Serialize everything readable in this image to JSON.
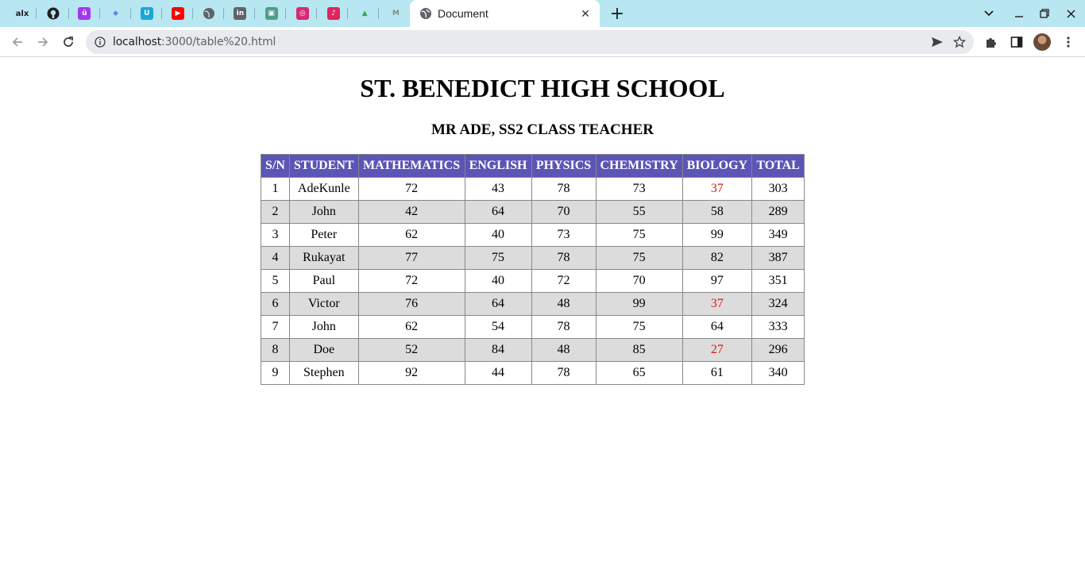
{
  "browser": {
    "pinned_tabs": [
      {
        "name": "alx-tab",
        "glyph": "alx",
        "color": "#1f1f1f",
        "bg": "transparent"
      },
      {
        "name": "github-tab",
        "glyph": "",
        "color": "#1f1f1f",
        "bg": "transparent"
      },
      {
        "name": "udemy-tab",
        "glyph": "ü",
        "color": "#ffffff",
        "bg": "#a435f0"
      },
      {
        "name": "sketch-tab",
        "glyph": "◆",
        "color": "#5b8def",
        "bg": "transparent"
      },
      {
        "name": "webflow-tab",
        "glyph": "U",
        "color": "#ffffff",
        "bg": "#1aa6d6"
      },
      {
        "name": "youtube-tab",
        "glyph": "▶",
        "color": "#ffffff",
        "bg": "#ff0000"
      },
      {
        "name": "web-tab",
        "glyph": "",
        "color": "#5f6368",
        "bg": "transparent"
      },
      {
        "name": "linkedin-tab",
        "glyph": "in",
        "color": "#ffffff",
        "bg": "#5f6368"
      },
      {
        "name": "sheet-tab",
        "glyph": "▣",
        "color": "#ffffff",
        "bg": "#4f9e8d"
      },
      {
        "name": "instagram-tab",
        "glyph": "◎",
        "color": "#ffffff",
        "bg": "#d62976"
      },
      {
        "name": "music-tab",
        "glyph": "♪",
        "color": "#ffffff",
        "bg": "#e0245e"
      },
      {
        "name": "drive-tab",
        "glyph": "▲",
        "color": "#34a853",
        "bg": "transparent"
      },
      {
        "name": "gmail-tab",
        "glyph": "M",
        "color": "#8a8a8a",
        "bg": "transparent"
      }
    ],
    "active_tab_title": "Document",
    "url_host": "localhost",
    "url_rest": ":3000/table%20.html",
    "tabstrip_color": "#b8e6f1"
  },
  "page": {
    "title": "ST. BENEDICT HIGH SCHOOL",
    "subtitle": "MR ADE, SS2 CLASS TEACHER",
    "table": {
      "headers": [
        "S/N",
        "STUDENT",
        "MATHEMATICS",
        "ENGLISH",
        "PHYSICS",
        "CHEMISTRY",
        "BIOLOGY",
        "TOTAL"
      ],
      "rows": [
        [
          "1",
          "AdeKunle",
          "72",
          "43",
          "78",
          "73",
          "37",
          "303"
        ],
        [
          "2",
          "John",
          "42",
          "64",
          "70",
          "55",
          "58",
          "289"
        ],
        [
          "3",
          "Peter",
          "62",
          "40",
          "73",
          "75",
          "99",
          "349"
        ],
        [
          "4",
          "Rukayat",
          "77",
          "75",
          "78",
          "75",
          "82",
          "387"
        ],
        [
          "5",
          "Paul",
          "72",
          "40",
          "72",
          "70",
          "97",
          "351"
        ],
        [
          "6",
          "Victor",
          "76",
          "64",
          "48",
          "99",
          "37",
          "324"
        ],
        [
          "7",
          "John",
          "62",
          "54",
          "78",
          "75",
          "64",
          "333"
        ],
        [
          "8",
          "Doe",
          "52",
          "84",
          "48",
          "85",
          "27",
          "296"
        ],
        [
          "9",
          "Stephen",
          "92",
          "44",
          "78",
          "65",
          "61",
          "340"
        ]
      ],
      "header_color": "#5b55b5",
      "alt_row_color": "#dcdcdc",
      "fail_color": "#e0191b",
      "fail_cells": [
        [
          0,
          6
        ],
        [
          5,
          6
        ],
        [
          7,
          6
        ]
      ]
    }
  }
}
